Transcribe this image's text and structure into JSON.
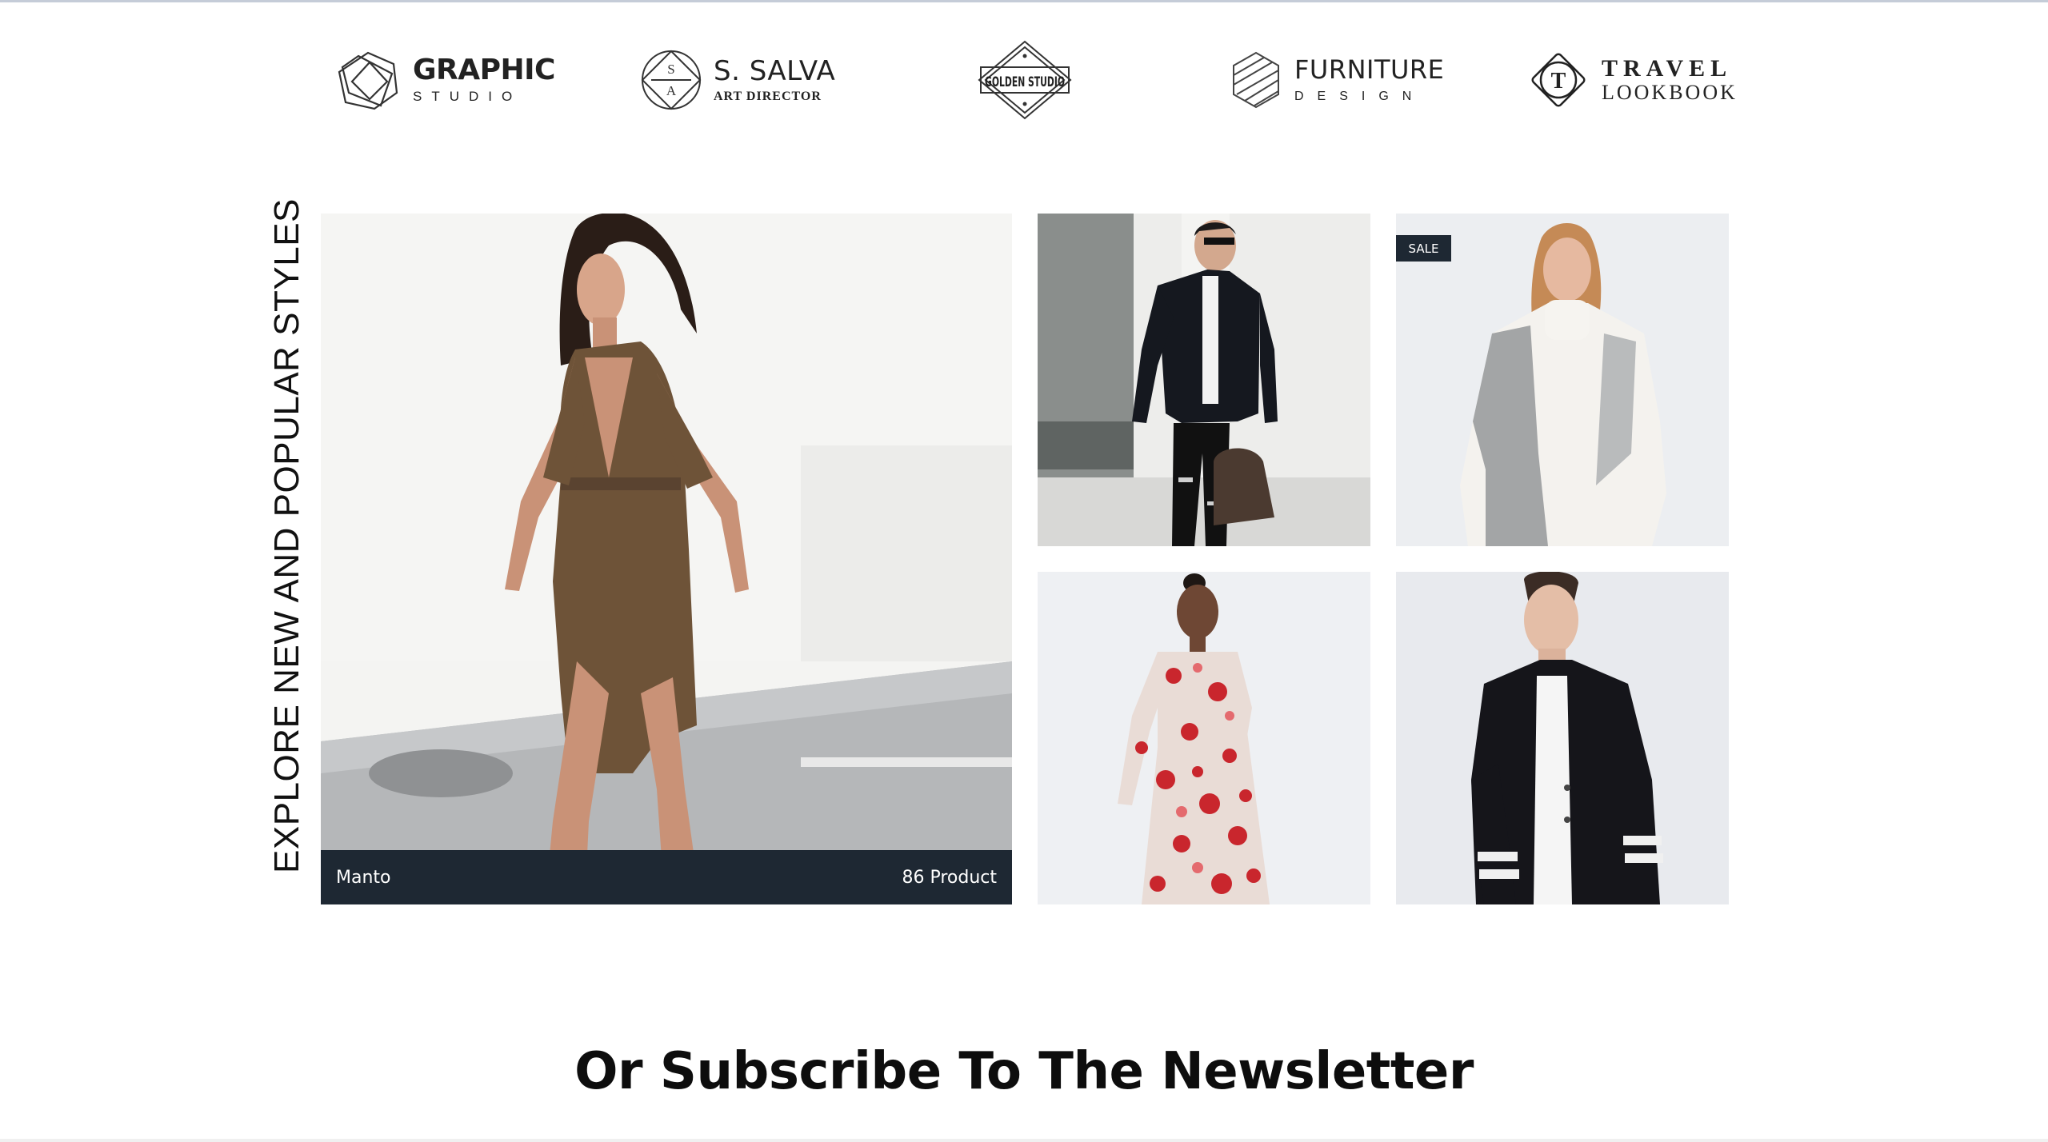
{
  "brands": {
    "graphic": {
      "line1": "GRAPHIC",
      "line2": "STUDIO"
    },
    "salva": {
      "line1": "S. SALVA",
      "line2": "ART DIRECTOR",
      "mark_top": "S",
      "mark_bottom": "A"
    },
    "golden": {
      "text": "GOLDEN STUDIO"
    },
    "furniture": {
      "line1": "FURNITURE",
      "line2": "DESIGN"
    },
    "travel": {
      "line1": "TRAVEL",
      "line2": "LOOKBOOK",
      "mark": "T"
    }
  },
  "explore": {
    "title": "EXPLORE NEW AND POPULAR STYLES",
    "featured": {
      "name": "Manto",
      "count": "86 Product"
    },
    "badge": "SALE"
  },
  "newsletter": {
    "title": "Or Subscribe To The Newsletter"
  },
  "colors": {
    "dark": "#1e2833",
    "text": "#111111"
  }
}
